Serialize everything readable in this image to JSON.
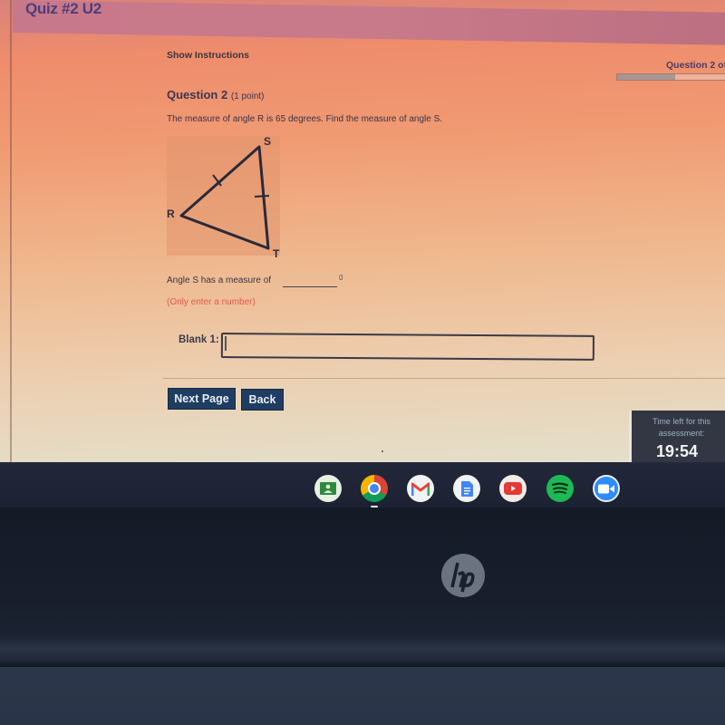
{
  "page": {
    "quiz_title": "Quiz #2 U2",
    "show_instructions": "Show Instructions",
    "question_counter": "Question 2 of",
    "question_progress_fraction": 0.5
  },
  "question": {
    "heading": "Question 2",
    "points": "(1 point)",
    "text": "The measure of angle R is 65 degrees.  Find the measure of angle S.",
    "figure": {
      "type": "triangle",
      "vertices": [
        "R",
        "S",
        "T"
      ],
      "congruent_sides": [
        "RS",
        "ST"
      ]
    },
    "answer_prompt": "Angle S has a measure of",
    "degree_symbol": "0",
    "hint": "(Only enter a number)"
  },
  "form": {
    "blank_label": "Blank 1:",
    "blank_value": "",
    "blank_placeholder": ""
  },
  "buttons": {
    "next_page": "Next Page",
    "back": "Back"
  },
  "timer": {
    "label": "Time left for this assessment:",
    "value": "19:54",
    "remaining_fraction": 0.35
  },
  "shelf": {
    "apps": [
      {
        "name": "Google Classroom",
        "icon": "classroom-icon",
        "color": "#2e8b3e"
      },
      {
        "name": "Chrome",
        "icon": "chrome-icon",
        "color": "#4285f4",
        "running": true
      },
      {
        "name": "Gmail",
        "icon": "gmail-icon",
        "color": "#ea4335"
      },
      {
        "name": "Google Docs",
        "icon": "docs-icon",
        "color": "#4285f4"
      },
      {
        "name": "YouTube",
        "icon": "youtube-icon",
        "color": "#e53935"
      },
      {
        "name": "Spotify",
        "icon": "spotify-icon",
        "color": "#1db954"
      },
      {
        "name": "Zoom",
        "icon": "zoom-icon",
        "color": "#2d8cff"
      }
    ]
  },
  "device": {
    "brand_logo": "hp"
  }
}
